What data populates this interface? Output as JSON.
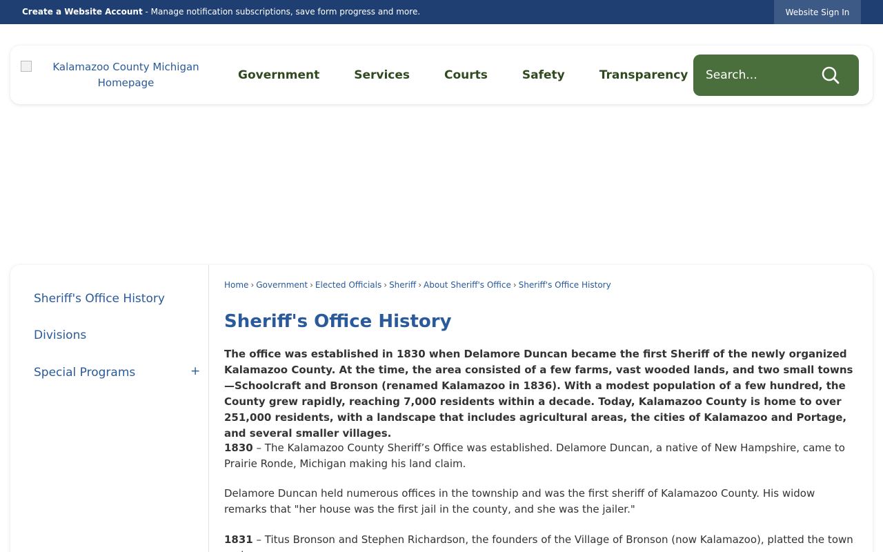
{
  "topbar": {
    "account_link": "Create a Website Account",
    "account_desc": " - Manage notification subscriptions, save form progress and more.",
    "signin_label": "Website Sign In"
  },
  "header": {
    "logo_alt": "Kalamazoo County Michigan Homepage",
    "nav": [
      "Government",
      "Services",
      "Courts",
      "Safety",
      "Transparency"
    ],
    "search_placeholder": "Search...",
    "search_icon": "search-icon"
  },
  "sidebar": {
    "items": [
      {
        "label": "Sheriff's Office History"
      },
      {
        "label": "Divisions"
      },
      {
        "label": "Special Programs",
        "expander": "+"
      }
    ]
  },
  "breadcrumb": [
    "Home",
    "Government",
    "Elected Officials",
    "Sheriff",
    "About Sheriff's Office",
    "Sheriff's Office History"
  ],
  "breadcrumb_sep": "›",
  "page": {
    "title": "Sheriff's Office History",
    "intro": "The office was established in 1830 when Delamore Duncan became the first Sheriff of the newly organized Kalamazoo County. At the time, the area consisted of a few farms, vast wooded lands, and two small towns—Schoolcraft and Bronson (renamed Kalamazoo in 1836). With a modest population of a few hundred, the County grew rapidly, reaching 7,000 residents within a decade. Today, Kalamazoo County is home to over 251,000 residents, with a landscape that includes agricultural areas, the cities of Kalamazoo and Portage, and several smaller villages.",
    "entries": [
      {
        "year": "1830",
        "text": " – The Kalamazoo County Sheriff’s Office was established.  Delamore Duncan, a native of New Hampshire, came to Prairie Ronde, Michigan making his land claim."
      },
      {
        "year": "",
        "text": "Delamore Duncan held numerous offices in the township and was the first sheriff of Kalamazoo County. His widow remarks that \"her house was the first jail in the county, and she was the jailer.\""
      },
      {
        "year": "1831",
        "text": " – Titus Bronson and Stephen Richardson, the founders of the Village of Bronson (now Kalamazoo), platted the town and"
      }
    ]
  },
  "colors": {
    "topbar": "#1f3f72",
    "nav_text": "#2f4a1f",
    "search_bg": "#4a6f3c",
    "link": "#2a5a9a"
  }
}
